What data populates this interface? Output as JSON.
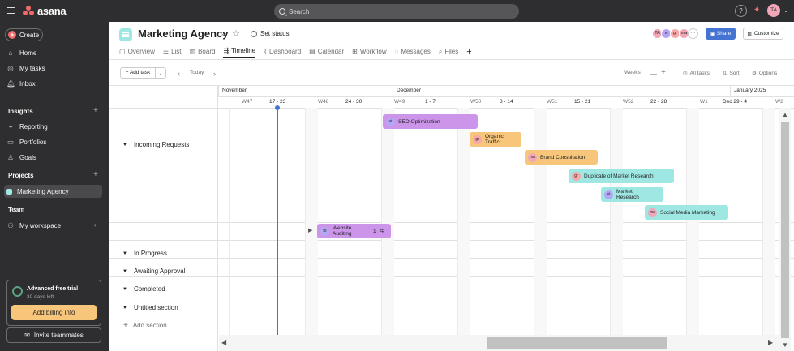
{
  "topbar": {
    "brand": "asana",
    "search_placeholder": "Search",
    "help_label": "?",
    "user_initials": "TA"
  },
  "sidebar": {
    "create_label": "Create",
    "nav": [
      {
        "label": "Home",
        "icon": "home-icon"
      },
      {
        "label": "My tasks",
        "icon": "check-circle-icon"
      },
      {
        "label": "Inbox",
        "icon": "bell-icon"
      }
    ],
    "insights_header": "Insights",
    "insights": [
      {
        "label": "Reporting",
        "icon": "chart-icon"
      },
      {
        "label": "Portfolios",
        "icon": "folder-icon"
      },
      {
        "label": "Goals",
        "icon": "person-icon"
      }
    ],
    "projects_header": "Projects",
    "projects": [
      {
        "label": "Marketing Agency",
        "color": "#9ee7e3"
      }
    ],
    "team_header": "Team",
    "team": [
      {
        "label": "My workspace"
      }
    ],
    "trial": {
      "title": "Advanced free trial",
      "subtitle": "30 days left",
      "button": "Add billing info"
    },
    "invite_label": "Invite teammates"
  },
  "header": {
    "project_title": "Marketing Agency",
    "set_status_label": "Set status",
    "members": [
      {
        "initials": "TA",
        "color": "#f1a7b8"
      },
      {
        "initials": "vi",
        "color": "#b5a6f3"
      },
      {
        "initials": "gr",
        "color": "#f7a8a8"
      },
      {
        "initials": "ma",
        "color": "#f1a7b8"
      }
    ],
    "more_label": "···",
    "share_label": "Share",
    "customize_label": "Customize"
  },
  "tabs": [
    {
      "label": "Overview",
      "icon": "overview-icon"
    },
    {
      "label": "List",
      "icon": "list-icon"
    },
    {
      "label": "Board",
      "icon": "board-icon"
    },
    {
      "label": "Timeline",
      "icon": "timeline-icon",
      "active": true
    },
    {
      "label": "Dashboard",
      "icon": "dashboard-icon"
    },
    {
      "label": "Calendar",
      "icon": "calendar-icon"
    },
    {
      "label": "Workflow",
      "icon": "workflow-icon"
    },
    {
      "label": "Messages",
      "icon": "messages-icon"
    },
    {
      "label": "Files",
      "icon": "files-icon"
    },
    {
      "label": "+",
      "icon": "add-tab-icon"
    }
  ],
  "toolbar": {
    "add_task_label": "Add task",
    "today_label": "Today",
    "zoom_label": "Weeks",
    "filter_label": "All tasks",
    "sort_label": "Sort",
    "options_label": "Options"
  },
  "timeline": {
    "months": [
      "November",
      "December",
      "January 2025"
    ],
    "weeks": [
      "W47",
      "17 - 23",
      "W48",
      "24 - 30",
      "W49",
      "1 - 7",
      "W50",
      "8 - 14",
      "W51",
      "15 - 21",
      "W52",
      "22 - 28",
      "W1",
      "Dec 29 - 4",
      "W2"
    ]
  },
  "sections": [
    {
      "label": "Incoming Requests"
    },
    {
      "label": "In Progress"
    },
    {
      "label": "Awaiting Approval"
    },
    {
      "label": "Completed"
    },
    {
      "label": "Untitled section"
    }
  ],
  "add_section_label": "Add section",
  "tasks": [
    {
      "name": "SEO Optimization",
      "assignee": "vi",
      "color": "#cd95ea",
      "avatar_color": "#b5a6f3"
    },
    {
      "name": "Organic Traffic",
      "assignee": "gr",
      "color": "#f8c67a",
      "avatar_color": "#f7a8a8"
    },
    {
      "name": "Brand Consultation",
      "assignee": "ma",
      "color": "#f8c67a",
      "avatar_color": "#f1a7b8"
    },
    {
      "name": "Duplicate of Market Research",
      "assignee": "gr",
      "color": "#9ee7e3",
      "avatar_color": "#f7a8a8"
    },
    {
      "name": "Market Research",
      "assignee": "vi",
      "color": "#9ee7e3",
      "avatar_color": "#b5a6f3"
    },
    {
      "name": "Social Media Marketing",
      "assignee": "ma",
      "color": "#9ee7e3",
      "avatar_color": "#f1a7b8"
    },
    {
      "name": "Website Auditing",
      "assignee": "fo",
      "color": "#cd95ea",
      "avatar_color": "#b5a6f3",
      "subtasks": "1"
    }
  ]
}
